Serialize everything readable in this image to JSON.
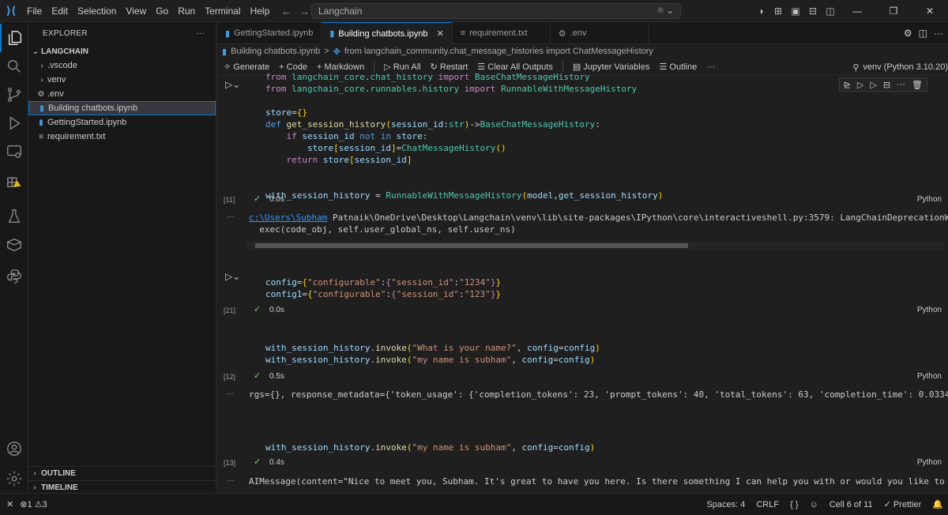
{
  "menu": [
    "File",
    "Edit",
    "Selection",
    "View",
    "Go",
    "Run",
    "Terminal",
    "Help"
  ],
  "command_center": "Langchain",
  "explorer": {
    "title": "EXPLORER",
    "more": "···",
    "folder": "LANGCHAIN",
    "items": [
      {
        "label": ".vscode",
        "type": "folder"
      },
      {
        "label": "venv",
        "type": "folder"
      },
      {
        "label": ".env",
        "type": "file"
      },
      {
        "label": "Building chatbots.ipynb",
        "type": "notebook",
        "selected": true
      },
      {
        "label": "GettingStarted.ipynb",
        "type": "notebook"
      },
      {
        "label": "requirement.txt",
        "type": "text"
      }
    ],
    "outline": "OUTLINE",
    "timeline": "TIMELINE"
  },
  "tabs": [
    {
      "label": "GettingStarted.ipynb",
      "active": false
    },
    {
      "label": "Building chatbots.ipynb",
      "active": true
    },
    {
      "label": "requirement.txt",
      "active": false
    },
    {
      "label": ".env",
      "active": false
    }
  ],
  "tab_close": "✕",
  "breadcrumb": {
    "file": "Building chatbots.ipynb",
    "sep": ">",
    "symbol": "from langchain_community.chat_message_histories import ChatMessageHistory"
  },
  "toolbar": {
    "generate": "Generate",
    "code": "Code",
    "markdown": "Markdown",
    "run_all": "Run All",
    "restart": "Restart",
    "clear_outputs": "Clear All Outputs",
    "variables": "Jupyter Variables",
    "outline": "Outline",
    "more": "···",
    "kernel": "venv (Python 3.10.20)"
  },
  "cells": {
    "c1": {
      "count": "[11]",
      "time": "0.0s",
      "lang": "Python",
      "output_path": "c:\\Users\\Subham",
      "output_rest": " Patnaik\\OneDrive\\Desktop\\Langchain\\venv\\lib\\site-packages\\IPython\\core\\interactiveshell.py:3579: LangChainDeprecationWarning: Runn",
      "output_line2": "  exec(code_obj, self.user_global_ns, self.user_ns)"
    },
    "c2": {
      "count": "[21]",
      "time": "0.0s",
      "lang": "Python"
    },
    "c3": {
      "count": "[12]",
      "time": "0.5s",
      "lang": "Python",
      "output": "rgs={}, response_metadata={'token_usage': {'completion_tokens': 23, 'prompt_tokens': 40, 'total_tokens': 63, 'completion_time': 0.033483244, 'comp:"
    },
    "c4": {
      "count": "[13]",
      "time": "0.4s",
      "lang": "Python",
      "output": "AIMessage(content=\"Nice to meet you, Subham. It's great to have you here. Is there something I can help you with or would you like to chat?\", addi"
    }
  },
  "statusbar": {
    "errors": "1",
    "warnings": "3",
    "spaces": "Spaces: 4",
    "eol": "CRLF",
    "braces": "{ }",
    "cell": "Cell 6 of 11",
    "prettier": "✓ Prettier"
  },
  "colors": {
    "accent": "#0078d4",
    "success": "#89d185",
    "keyword": "#569cd6",
    "function": "#dcdcaa",
    "class": "#4ec9b0",
    "string": "#ce9178"
  }
}
